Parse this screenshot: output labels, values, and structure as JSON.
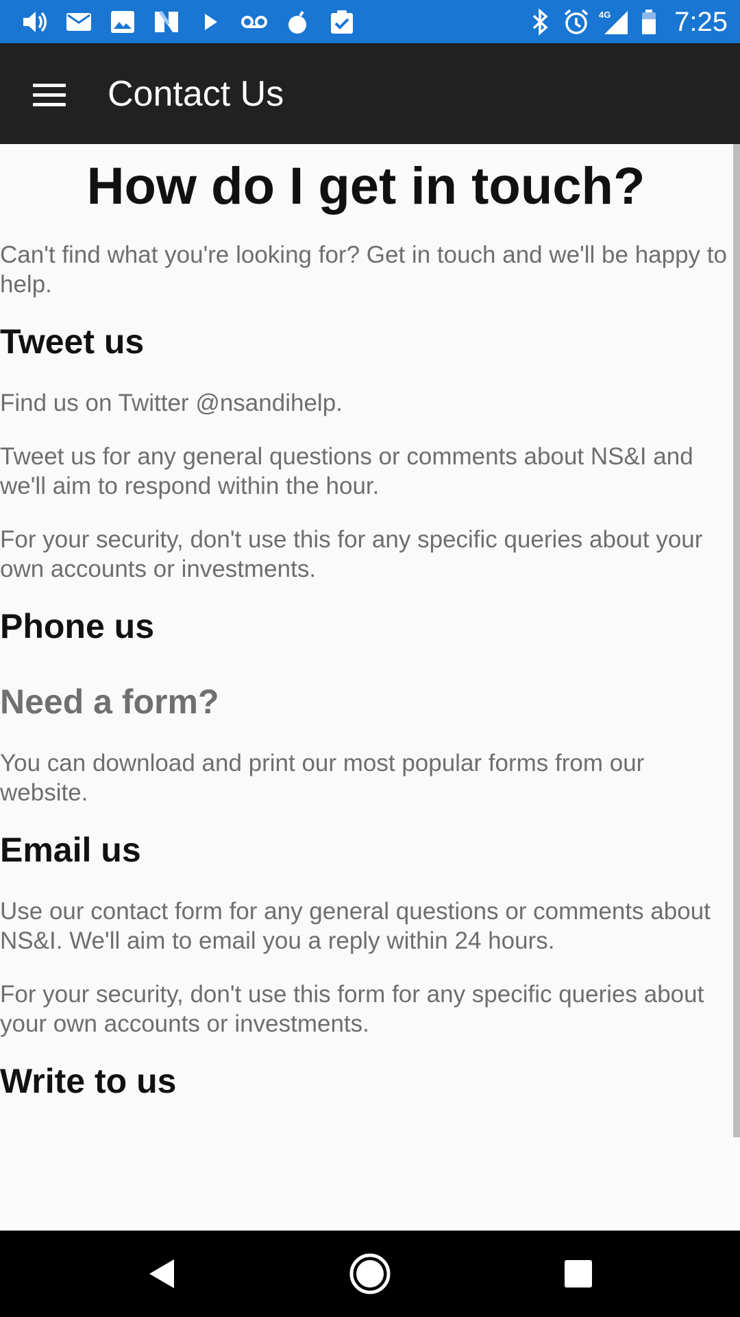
{
  "status_bar": {
    "time": "7:25",
    "network_label": "4G",
    "left_icons": [
      "volume-icon",
      "mail-icon",
      "image-icon",
      "n-app-icon",
      "play-icon",
      "voicemail-icon",
      "bomb-icon",
      "clipboard-check-icon"
    ],
    "right_icons": [
      "bluetooth-icon",
      "alarm-icon",
      "signal-icon",
      "battery-icon"
    ],
    "color": "#1976d2"
  },
  "app_bar": {
    "title": "Contact Us",
    "menu_icon": "hamburger-menu-icon",
    "color": "#212121"
  },
  "content": {
    "heading": "How do I get in touch?",
    "intro": "Can't find what you're looking for? Get in touch and we'll be happy to help.",
    "tweet": {
      "title": "Tweet us",
      "p1": "Find us on Twitter @nsandihelp.",
      "p2": "Tweet us for any general questions or comments about NS&I and we'll aim to respond within the hour.",
      "p3": "For your security, don't use this for any specific queries about your own accounts or investments."
    },
    "phone": {
      "title": "Phone us"
    },
    "form": {
      "title": "Need a form?",
      "p1": "You can download and print our most popular forms from our website."
    },
    "email": {
      "title": "Email us",
      "p1": "Use our contact form for any general questions or comments about NS&I. We'll aim to email you a reply within 24 hours.",
      "p2": "For your security, don't use this form for any specific queries about your own accounts or investments."
    },
    "write": {
      "title": "Write to us"
    }
  },
  "nav_bar": {
    "buttons": [
      "back-icon",
      "home-icon",
      "recents-icon"
    ]
  }
}
